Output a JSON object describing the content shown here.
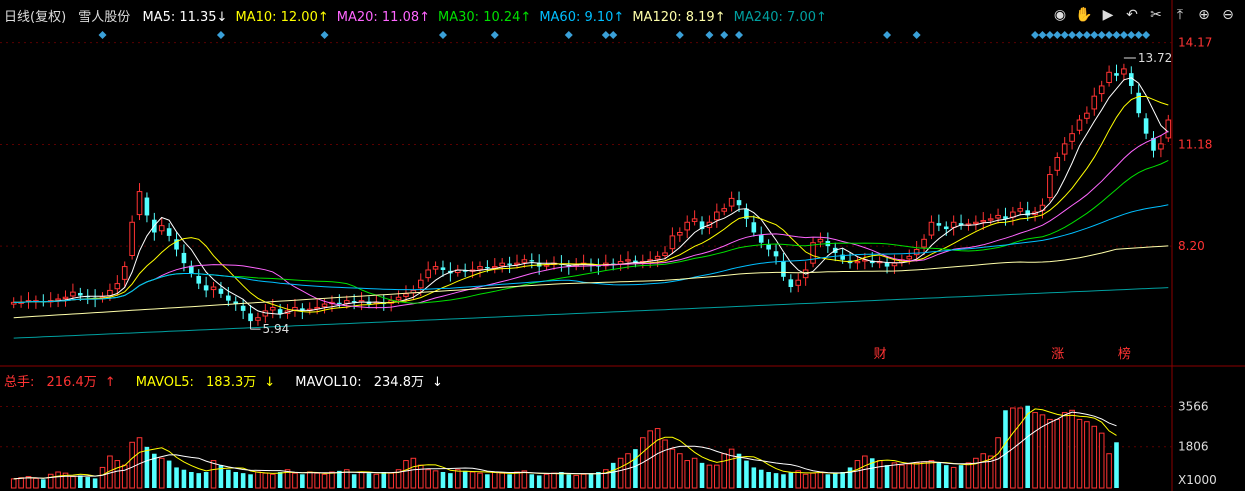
{
  "header": {
    "period": "日线(复权)",
    "stock_name": "雪人股份",
    "ma": [
      {
        "label": "MA5",
        "value": "11.35",
        "arrow": "↓",
        "color": "#ffffff"
      },
      {
        "label": "MA10",
        "value": "12.00",
        "arrow": "↑",
        "color": "#ffff00"
      },
      {
        "label": "MA20",
        "value": "11.08",
        "arrow": "↑",
        "color": "#ff66ff"
      },
      {
        "label": "MA30",
        "value": "10.24",
        "arrow": "↑",
        "color": "#00e000"
      },
      {
        "label": "MA60",
        "value": "9.10",
        "arrow": "↑",
        "color": "#00bfff"
      },
      {
        "label": "MA120",
        "value": "8.19",
        "arrow": "↑",
        "color": "#ffffaa"
      },
      {
        "label": "MA240",
        "value": "7.00",
        "arrow": "↑",
        "color": "#00a0a0"
      }
    ]
  },
  "toolbar_icons": [
    "eye-icon",
    "hand-icon",
    "play-icon",
    "undo-icon",
    "cut-icon",
    "up-icon",
    "zoom-in-icon",
    "zoom-out-icon"
  ],
  "volume_header": {
    "total_label": "总手:",
    "total_value": "216.4万",
    "total_arrow": "↑",
    "mavol5_label": "MAVOL5:",
    "mavol5_value": "183.3万",
    "mavol5_arrow": "↓",
    "mavol10_label": "MAVOL10:",
    "mavol10_value": "234.8万",
    "mavol10_arrow": "↓"
  },
  "chart_data": {
    "type": "candlestick",
    "price_axis": {
      "ticks": [
        "14.17",
        "11.18",
        "8.20"
      ],
      "range": [
        4.8,
        14.6
      ]
    },
    "volume_axis": {
      "ticks": [
        "3566",
        "1806"
      ],
      "unit": "X1000",
      "range": [
        0,
        4200
      ]
    },
    "annotations": {
      "high": "13.72",
      "low": "5.94"
    },
    "event_labels": [
      {
        "text": "财",
        "index": 117
      },
      {
        "text": "涨",
        "index": 141
      },
      {
        "text": "榜",
        "index": 150
      }
    ],
    "colors": {
      "up": "#ff3333",
      "down": "#54ffff",
      "mavol5": "#ffff00",
      "mavol10": "#ffffff"
    },
    "diamond_indices": [
      12,
      28,
      42,
      58,
      65,
      75,
      80,
      81,
      90,
      94,
      96,
      98,
      118,
      122,
      138,
      139,
      140,
      141,
      142,
      143,
      144,
      145,
      146,
      147,
      148,
      149,
      150,
      151,
      152,
      153
    ],
    "candles_note": "generated series",
    "closes": [
      6.55,
      6.55,
      6.6,
      6.6,
      6.55,
      6.6,
      6.65,
      6.7,
      6.85,
      6.75,
      6.7,
      6.65,
      6.7,
      6.9,
      7.1,
      7.6,
      8.9,
      9.8,
      9.1,
      8.6,
      8.8,
      8.5,
      8.1,
      7.7,
      7.4,
      7.1,
      6.9,
      7.0,
      6.8,
      6.6,
      6.5,
      6.3,
      6.0,
      6.1,
      6.3,
      6.4,
      6.2,
      6.3,
      6.4,
      6.3,
      6.35,
      6.4,
      6.5,
      6.55,
      6.5,
      6.6,
      6.55,
      6.6,
      6.5,
      6.55,
      6.5,
      6.6,
      6.7,
      6.8,
      6.9,
      7.2,
      7.5,
      7.6,
      7.5,
      7.4,
      7.5,
      7.45,
      7.5,
      7.6,
      7.55,
      7.6,
      7.7,
      7.65,
      7.7,
      7.8,
      7.75,
      7.6,
      7.65,
      7.7,
      7.65,
      7.6,
      7.65,
      7.7,
      7.65,
      7.6,
      7.7,
      7.65,
      7.75,
      7.8,
      7.7,
      7.75,
      7.8,
      7.9,
      8.0,
      8.5,
      8.6,
      8.9,
      9.0,
      8.7,
      8.9,
      9.2,
      9.3,
      9.6,
      9.4,
      9.0,
      8.6,
      8.3,
      8.1,
      7.9,
      7.3,
      7.0,
      7.2,
      7.5,
      8.3,
      8.4,
      8.2,
      8.0,
      7.8,
      7.7,
      7.75,
      7.8,
      7.7,
      7.75,
      7.6,
      7.7,
      7.8,
      7.9,
      8.1,
      8.4,
      8.9,
      8.8,
      8.7,
      8.9,
      8.8,
      8.85,
      8.9,
      8.95,
      9.0,
      9.1,
      9.0,
      9.2,
      9.3,
      9.1,
      9.2,
      9.4,
      10.3,
      10.8,
      11.2,
      11.5,
      11.9,
      12.1,
      12.6,
      12.9,
      13.3,
      13.2,
      13.4,
      12.9,
      12.1,
      11.5,
      11.0,
      11.2,
      11.9
    ],
    "volumes": [
      400,
      450,
      500,
      420,
      380,
      600,
      700,
      650,
      500,
      550,
      480,
      420,
      900,
      1400,
      1200,
      1000,
      2000,
      2200,
      1800,
      1500,
      1300,
      1200,
      900,
      800,
      700,
      650,
      700,
      1200,
      1000,
      800,
      700,
      650,
      600,
      700,
      650,
      600,
      700,
      800,
      650,
      600,
      700,
      650,
      600,
      700,
      750,
      800,
      600,
      700,
      650,
      600,
      700,
      650,
      800,
      1200,
      1300,
      1000,
      800,
      750,
      700,
      650,
      800,
      750,
      700,
      650,
      600,
      700,
      650,
      600,
      700,
      750,
      600,
      550,
      600,
      650,
      700,
      600,
      550,
      600,
      650,
      700,
      800,
      1100,
      1300,
      1500,
      1700,
      2200,
      2500,
      2600,
      2100,
      1700,
      1500,
      1200,
      1300,
      1100,
      1000,
      1000,
      1500,
      1700,
      1500,
      1200,
      900,
      800,
      700,
      650,
      600,
      700,
      750,
      600,
      650,
      700,
      600,
      650,
      700,
      900,
      1200,
      1400,
      1300,
      1200,
      1000,
      1100,
      1000,
      1050,
      1100,
      1150,
      1200,
      1100,
      1000,
      900,
      1000,
      1100,
      1300,
      1500,
      1400,
      2200,
      3400,
      3500,
      3500,
      3600,
      3300,
      3200,
      3000,
      3000,
      3300,
      3400,
      3000,
      2900,
      2700,
      2400,
      1500,
      2000
    ],
    "ma_lines": {
      "ma5": {
        "color": "#ffffff"
      },
      "ma10": {
        "color": "#ffff00"
      },
      "ma20": {
        "color": "#ff66ff"
      },
      "ma30": {
        "color": "#00e000"
      },
      "ma60": {
        "color": "#00bfff"
      },
      "ma120": {
        "color": "#ffffaa"
      },
      "ma240": {
        "color": "#00a0a0"
      }
    }
  }
}
